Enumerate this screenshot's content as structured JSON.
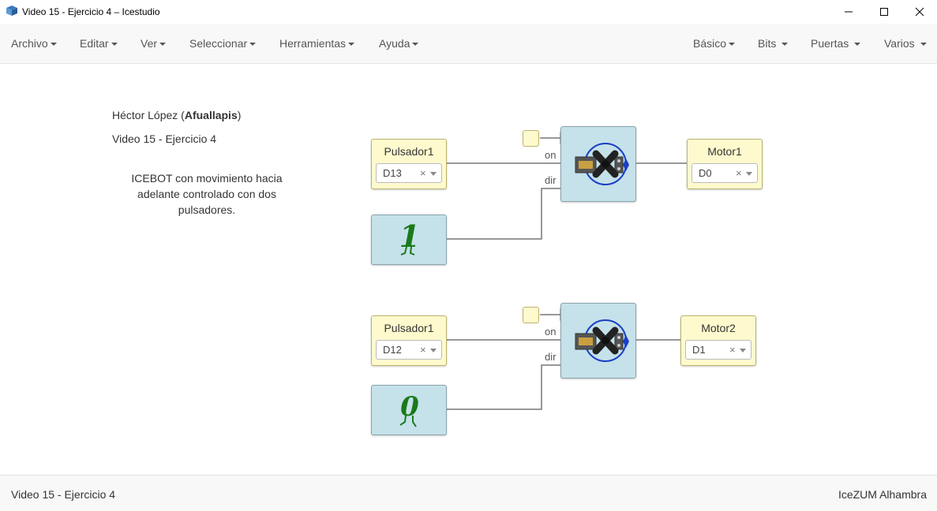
{
  "window": {
    "title": "Video 15 - Ejercicio 4 – Icestudio"
  },
  "menu": {
    "left": [
      "Archivo",
      "Editar",
      "Ver",
      "Seleccionar",
      "Herramientas",
      "Ayuda"
    ],
    "right": [
      "Básico",
      "Bits",
      "Puertas",
      "Varios"
    ]
  },
  "info": {
    "author_name": "Héctor López (",
    "author_nick": "Afuallapis",
    "author_close": ")",
    "project": "Video 15 - Ejercicio 4",
    "description": "ICEBOT con movimiento hacia adelante controlado con dos pulsadores."
  },
  "circuit1": {
    "input_label": "Pulsador1",
    "input_pin": "D13",
    "const_value": "1",
    "port_on": "on",
    "port_dir": "dir",
    "output_label": "Motor1",
    "output_pin": "D0"
  },
  "circuit2": {
    "input_label": "Pulsador1",
    "input_pin": "D12",
    "const_value": "0",
    "port_on": "on",
    "port_dir": "dir",
    "output_label": "Motor2",
    "output_pin": "D1"
  },
  "footer": {
    "left": "Video 15 - Ejercicio 4",
    "right": "IceZUM Alhambra"
  },
  "icons": {
    "app": "icestudio-logo-icon",
    "minimize": "minimize-icon",
    "maximize": "maximize-icon",
    "close": "close-icon",
    "servo": "servo-motor-icon"
  },
  "colors": {
    "io_block": "#fffacd",
    "logic_block": "#c5e1ea",
    "constant_glyph": "#1a7a1a",
    "wire": "#777777"
  }
}
